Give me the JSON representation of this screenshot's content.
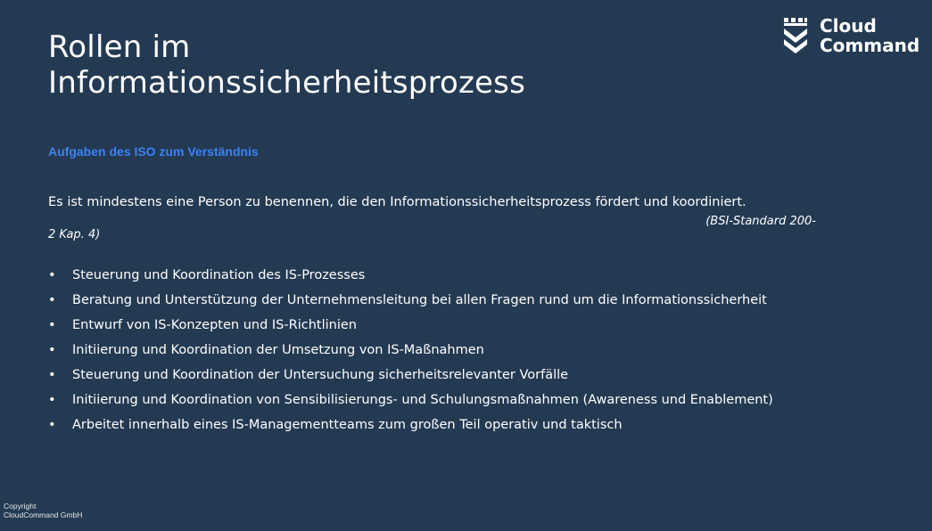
{
  "slide": {
    "title_line1": "Rollen im",
    "title_line2": "Informationssicherheitsprozess",
    "subtitle": "Aufgaben des ISO zum Verständnis",
    "intro": "Es ist mindestens eine Person zu benennen, die den Informationssicherheitsprozess fördert und koordiniert.",
    "citation_part1": "(BSI-Standard 200-",
    "citation_part2": "2 Kap. 4)",
    "bullet_symbol": "•",
    "bullets": [
      "Steuerung und Koordination des IS-Prozesses",
      "Beratung und Unterstützung der Unternehmensleitung bei allen Fragen rund um die Informationssicherheit",
      "Entwurf von IS-Konzepten und IS-Richtlinien",
      "Initiierung und Koordination der Umsetzung von IS-Maßnahmen",
      "Steuerung und Koordination der Untersuchung sicherheitsrelevanter Vorfälle",
      "Initiierung und Koordination von Sensibilisierungs- und Schulungsmaßnahmen (Awareness und Enablement)",
      "Arbeitet innerhalb eines IS-Managementteams zum großen Teil operativ und taktisch"
    ]
  },
  "logo": {
    "text": "Cloud\nCommand",
    "icon": "shield-chevron-icon"
  },
  "footer": {
    "line1": "Copyright",
    "line2": "CloudCommand GmbH"
  },
  "colors": {
    "background": "#243a52",
    "accent": "#3b82f6",
    "text": "#ffffff"
  }
}
